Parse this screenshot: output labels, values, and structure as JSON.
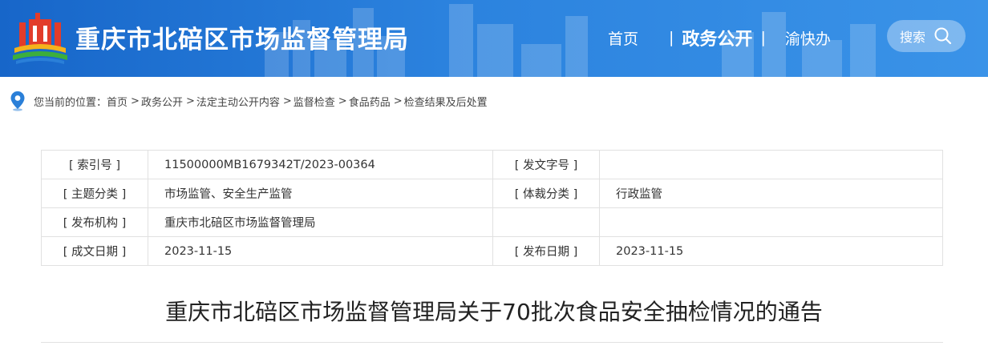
{
  "header": {
    "site_title": "重庆市北碚区市场监督管理局",
    "nav": {
      "home": "首页",
      "gov_open": "政务公开",
      "yukuaiban": "渝快办",
      "sep": "|"
    },
    "search_label": "搜索"
  },
  "breadcrumb": {
    "prefix": "您当前的位置：",
    "items": [
      "首页",
      "政务公开",
      "法定主动公开内容",
      "监督检查",
      "食品药品",
      "检查结果及后处置"
    ],
    "arrow": ">"
  },
  "meta": {
    "index_no_label": "[ 索引号 ]",
    "index_no": "11500000MB1679342T/2023-00364",
    "doc_no_label": "[ 发文字号 ]",
    "doc_no": "",
    "topic_label": "[ 主题分类 ]",
    "topic": "市场监管、安全生产监管",
    "genre_label": "[ 体裁分类 ]",
    "genre": "行政监管",
    "issuer_label": "[ 发布机构 ]",
    "issuer": "重庆市北碚区市场监督管理局",
    "created_label": "[ 成文日期 ]",
    "created": "2023-11-15",
    "published_label": "[ 发布日期 ]",
    "published": "2023-11-15"
  },
  "document": {
    "title": "重庆市北碚区市场监督管理局关于70批次食品安全抽检情况的通告"
  },
  "colors": {
    "header_blue": "#1766c9",
    "header_blue_light": "#3a93e8",
    "logo_red": "#e23c2a",
    "logo_yellow": "#f5b21c",
    "logo_green": "#3cae3c",
    "pin_blue": "#2a7fd8"
  },
  "icons": {
    "logo": "building-emblem-icon",
    "search": "magnifier-icon",
    "location": "location-pin-icon"
  }
}
